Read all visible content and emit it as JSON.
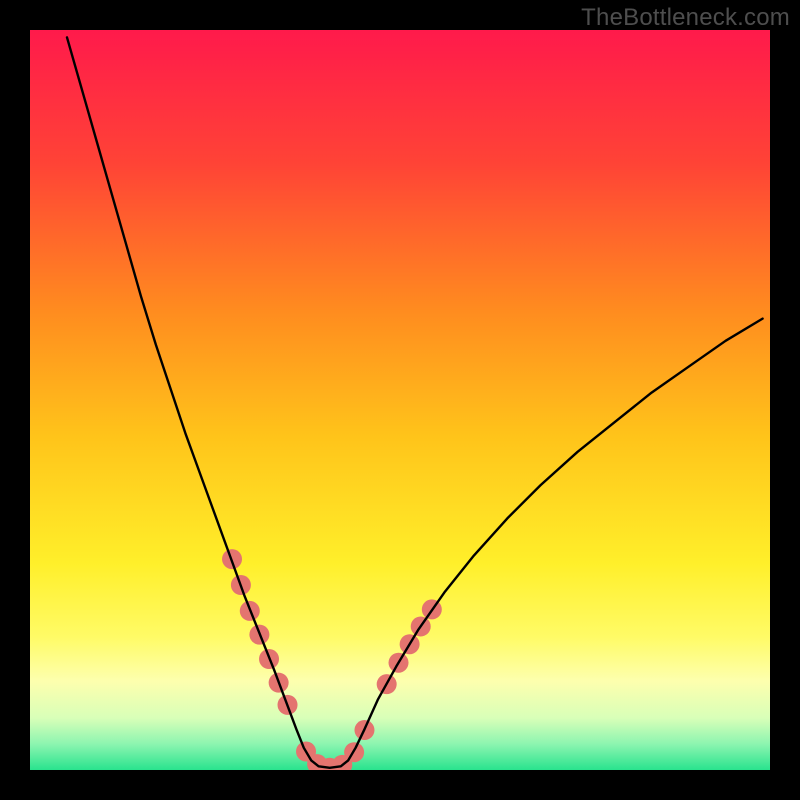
{
  "watermark": "TheBottleneck.com",
  "chart_data": {
    "type": "line",
    "title": "",
    "xlabel": "",
    "ylabel": "",
    "xlim": [
      0,
      100
    ],
    "ylim": [
      0,
      100
    ],
    "grid": false,
    "legend": false,
    "background_gradient_stops": [
      {
        "offset": 0.0,
        "color": "#ff1a4b"
      },
      {
        "offset": 0.18,
        "color": "#ff4336"
      },
      {
        "offset": 0.38,
        "color": "#ff8c1f"
      },
      {
        "offset": 0.55,
        "color": "#ffc41a"
      },
      {
        "offset": 0.72,
        "color": "#ffef2a"
      },
      {
        "offset": 0.82,
        "color": "#fffb66"
      },
      {
        "offset": 0.88,
        "color": "#fdffae"
      },
      {
        "offset": 0.93,
        "color": "#d8ffb8"
      },
      {
        "offset": 0.965,
        "color": "#8cf5b0"
      },
      {
        "offset": 1.0,
        "color": "#29e38e"
      }
    ],
    "series": [
      {
        "name": "curve",
        "color": "#000000",
        "stroke_width": 2.4,
        "points": [
          {
            "x": 5.0,
            "y": 99.0
          },
          {
            "x": 7.0,
            "y": 92.0
          },
          {
            "x": 9.0,
            "y": 85.0
          },
          {
            "x": 11.0,
            "y": 78.0
          },
          {
            "x": 13.0,
            "y": 71.0
          },
          {
            "x": 15.0,
            "y": 64.0
          },
          {
            "x": 17.0,
            "y": 57.5
          },
          {
            "x": 19.0,
            "y": 51.5
          },
          {
            "x": 21.0,
            "y": 45.5
          },
          {
            "x": 23.0,
            "y": 40.0
          },
          {
            "x": 25.0,
            "y": 34.5
          },
          {
            "x": 27.0,
            "y": 29.0
          },
          {
            "x": 29.0,
            "y": 23.5
          },
          {
            "x": 31.0,
            "y": 18.5
          },
          {
            "x": 33.0,
            "y": 13.5
          },
          {
            "x": 34.5,
            "y": 9.5
          },
          {
            "x": 36.0,
            "y": 5.5
          },
          {
            "x": 37.0,
            "y": 3.0
          },
          {
            "x": 38.0,
            "y": 1.3
          },
          {
            "x": 39.0,
            "y": 0.5
          },
          {
            "x": 40.5,
            "y": 0.3
          },
          {
            "x": 42.0,
            "y": 0.5
          },
          {
            "x": 43.0,
            "y": 1.3
          },
          {
            "x": 44.0,
            "y": 3.0
          },
          {
            "x": 45.2,
            "y": 5.5
          },
          {
            "x": 47.0,
            "y": 9.5
          },
          {
            "x": 49.5,
            "y": 14.0
          },
          {
            "x": 52.5,
            "y": 19.0
          },
          {
            "x": 56.0,
            "y": 24.0
          },
          {
            "x": 60.0,
            "y": 29.0
          },
          {
            "x": 64.5,
            "y": 34.0
          },
          {
            "x": 69.0,
            "y": 38.5
          },
          {
            "x": 74.0,
            "y": 43.0
          },
          {
            "x": 79.0,
            "y": 47.0
          },
          {
            "x": 84.0,
            "y": 51.0
          },
          {
            "x": 89.0,
            "y": 54.5
          },
          {
            "x": 94.0,
            "y": 58.0
          },
          {
            "x": 99.0,
            "y": 61.0
          }
        ]
      }
    ],
    "dot_overlay": {
      "color": "#e4746f",
      "radius": 10,
      "ranges_x": [
        {
          "from": 27.0,
          "to": 35.0
        },
        {
          "from": 36.5,
          "to": 46.0
        },
        {
          "from": 47.5,
          "to": 55.0
        }
      ],
      "dots": [
        {
          "x": 27.3,
          "y": 28.5
        },
        {
          "x": 28.5,
          "y": 25.0
        },
        {
          "x": 29.7,
          "y": 21.5
        },
        {
          "x": 31.0,
          "y": 18.3
        },
        {
          "x": 32.3,
          "y": 15.0
        },
        {
          "x": 33.6,
          "y": 11.8
        },
        {
          "x": 34.8,
          "y": 8.8
        },
        {
          "x": 37.3,
          "y": 2.5
        },
        {
          "x": 38.8,
          "y": 0.8
        },
        {
          "x": 40.5,
          "y": 0.3
        },
        {
          "x": 42.2,
          "y": 0.7
        },
        {
          "x": 43.8,
          "y": 2.4
        },
        {
          "x": 45.2,
          "y": 5.4
        },
        {
          "x": 48.2,
          "y": 11.6
        },
        {
          "x": 49.8,
          "y": 14.5
        },
        {
          "x": 51.3,
          "y": 17.0
        },
        {
          "x": 52.8,
          "y": 19.4
        },
        {
          "x": 54.3,
          "y": 21.7
        }
      ]
    }
  }
}
